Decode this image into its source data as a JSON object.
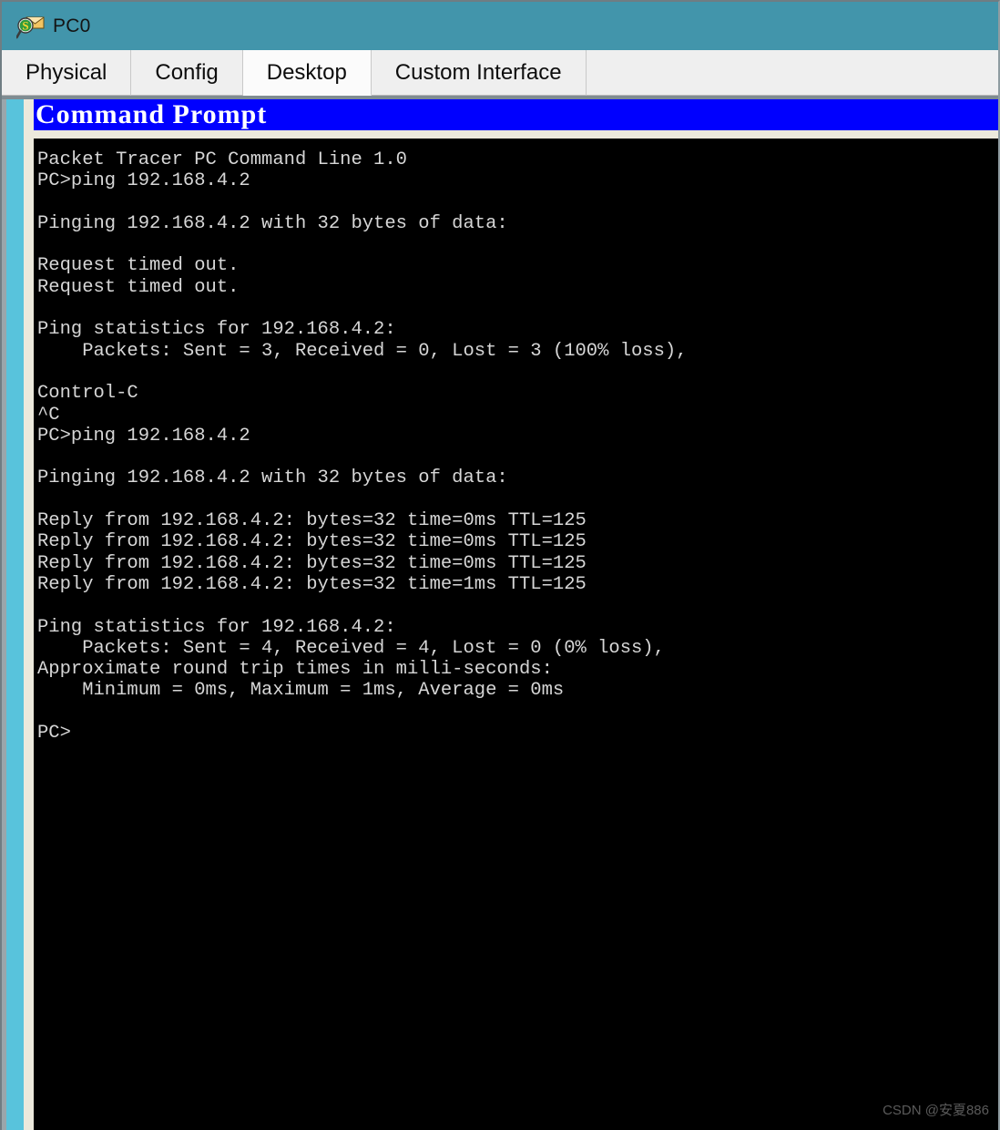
{
  "window": {
    "title": "PC0",
    "icon": "packet-tracer-device-icon",
    "titlebar_color": "#4295ab"
  },
  "tabs": [
    {
      "label": "Physical",
      "selected": false
    },
    {
      "label": "Config",
      "selected": false
    },
    {
      "label": "Desktop",
      "selected": true
    },
    {
      "label": "Custom Interface",
      "selected": false
    }
  ],
  "application": {
    "title": "Command Prompt",
    "titlebar_color": "#0000ff",
    "title_text_color": "#ffffff"
  },
  "terminal": {
    "background": "#000000",
    "foreground": "#d6d6d6",
    "lines": [
      "Packet Tracer PC Command Line 1.0",
      "PC>ping 192.168.4.2",
      "",
      "Pinging 192.168.4.2 with 32 bytes of data:",
      "",
      "Request timed out.",
      "Request timed out.",
      "",
      "Ping statistics for 192.168.4.2:",
      "    Packets: Sent = 3, Received = 0, Lost = 3 (100% loss),",
      "",
      "Control-C",
      "^C",
      "PC>ping 192.168.4.2",
      "",
      "Pinging 192.168.4.2 with 32 bytes of data:",
      "",
      "Reply from 192.168.4.2: bytes=32 time=0ms TTL=125",
      "Reply from 192.168.4.2: bytes=32 time=0ms TTL=125",
      "Reply from 192.168.4.2: bytes=32 time=0ms TTL=125",
      "Reply from 192.168.4.2: bytes=32 time=1ms TTL=125",
      "",
      "Ping statistics for 192.168.4.2:",
      "    Packets: Sent = 4, Received = 4, Lost = 0 (0% loss),",
      "Approximate round trip times in milli-seconds:",
      "    Minimum = 0ms, Maximum = 1ms, Average = 0ms",
      "",
      "PC>"
    ]
  },
  "watermark": {
    "text": "CSDN @安夏886"
  }
}
